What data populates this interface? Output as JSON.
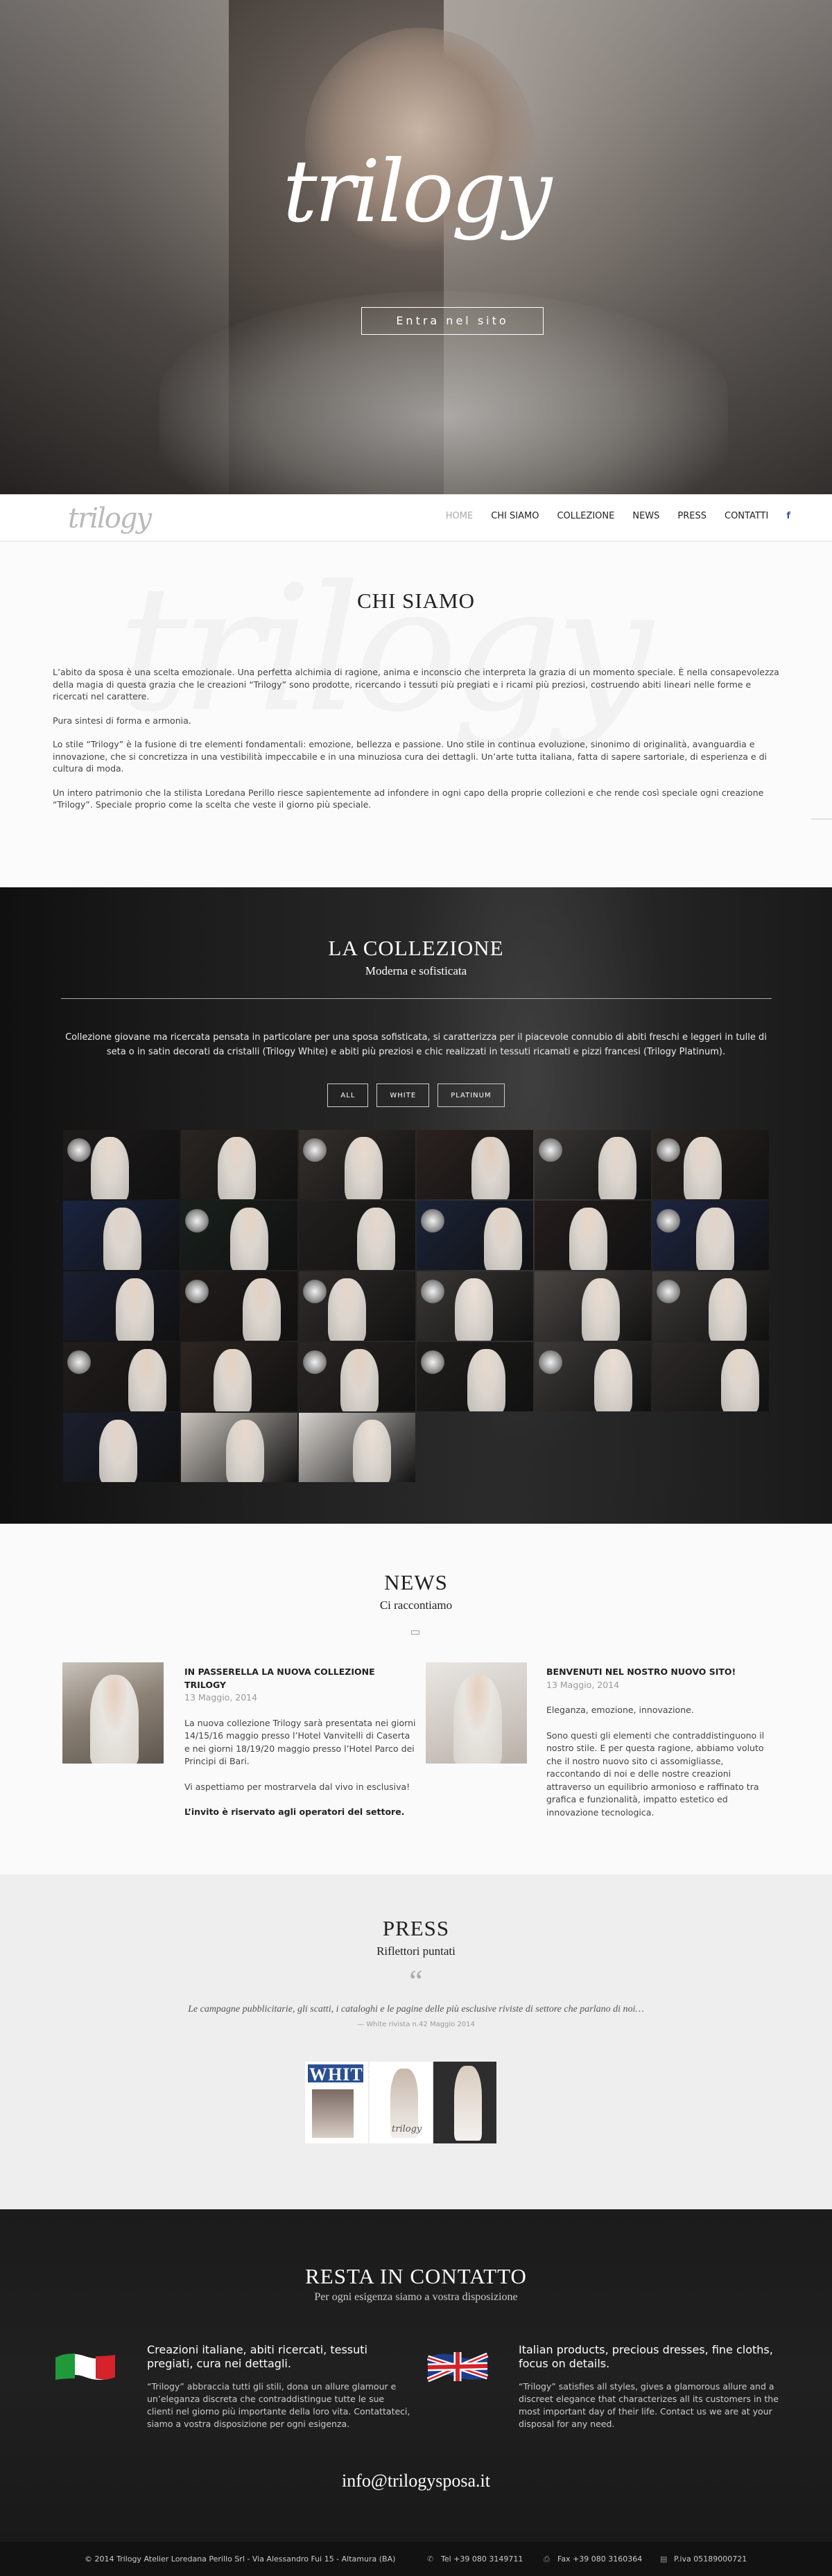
{
  "hero": {
    "logo": "trilogy",
    "enter_label": "Entra nel sito"
  },
  "nav": {
    "brand": "trilogy",
    "items": [
      {
        "label": "HOME",
        "active": true
      },
      {
        "label": "CHI SIAMO",
        "active": false
      },
      {
        "label": "COLLEZIONE",
        "active": false
      },
      {
        "label": "NEWS",
        "active": false
      },
      {
        "label": "PRESS",
        "active": false
      },
      {
        "label": "CONTATTI",
        "active": false
      }
    ],
    "social_icon": "facebook-icon",
    "social_glyph": "f"
  },
  "chi_siamo": {
    "watermark": "trilogy",
    "title": "CHI SIAMO",
    "paragraphs": [
      "L’abito da sposa è una scelta emozionale. Una perfetta alchimia di ragione, anima e inconscio che interpreta la grazia di un momento speciale. È nella consapevolezza della magia di questa grazia che le creazioni “Trilogy” sono prodotte, ricercando i tessuti più pregiati e i ricami più preziosi, costruendo abiti lineari nelle forme e ricercati nel carattere.",
      "Pura sintesi di forma e armonia.",
      "Lo stile “Trilogy” è la fusione di tre elementi fondamentali: emozione, bellezza e passione. Uno stile in continua evoluzione, sinonimo di originalità, avanguardia e innovazione, che si concretizza in una vestibilità impeccabile e in una minuziosa cura dei dettagli. Un’arte tutta italiana, fatta di sapere sartoriale, di esperienza e di cultura di moda.",
      "Un intero patrimonio che la stilista Loredana Perillo riesce sapientemente ad infondere in ogni capo della proprie collezioni e che rende così speciale ogni creazione “Trilogy”. Speciale proprio come la scelta che veste il giorno più speciale."
    ]
  },
  "collezione": {
    "title": "LA COLLEZIONE",
    "subtitle": "Moderna e sofisticata",
    "description": "Collezione giovane ma ricercata pensata in particolare per una sposa sofisticata, si caratterizza per il piacevole connubio di abiti freschi e leggeri in tulle di seta o in satin decorati da cristalli (Trilogy White) e abiti più preziosi e chic realizzati in tessuti ricamati e pizzi francesi (Trilogy Platinum).",
    "filters": [
      "ALL",
      "WHITE",
      "PLATINUM"
    ],
    "tiles": [
      {
        "bg": "#1d1a1a",
        "skin": "#e8d9cc",
        "lamp": true
      },
      {
        "bg": "#2a2522",
        "skin": "#e6d4c6",
        "lamp": false
      },
      {
        "bg": "#35302c",
        "skin": "#ead8c9",
        "lamp": true
      },
      {
        "bg": "#2b2220",
        "skin": "#e3cdbb",
        "lamp": false
      },
      {
        "bg": "#3a3734",
        "skin": "#e6d6ca",
        "lamp": true
      },
      {
        "bg": "#2a2420",
        "skin": "#e8d5c6",
        "lamp": true
      },
      {
        "bg": "#1a2440",
        "skin": "#e0d2c8",
        "lamp": false
      },
      {
        "bg": "#18201c",
        "skin": "#e6d4c4",
        "lamp": true
      },
      {
        "bg": "#22201e",
        "skin": "#e7d7ca",
        "lamp": false
      },
      {
        "bg": "#1c2338",
        "skin": "#e4d1c3",
        "lamp": true
      },
      {
        "bg": "#241d1c",
        "skin": "#ead6c6",
        "lamp": false
      },
      {
        "bg": "#1d2542",
        "skin": "#e4d4c9",
        "lamp": true
      },
      {
        "bg": "#1a1e30",
        "skin": "#e6d3c4",
        "lamp": false
      },
      {
        "bg": "#221c1a",
        "skin": "#e5d1c1",
        "lamp": true
      },
      {
        "bg": "#302c2a",
        "skin": "#e7d6c8",
        "lamp": true
      },
      {
        "bg": "#3b3836",
        "skin": "#ece0d6",
        "lamp": true
      },
      {
        "bg": "#4a4643",
        "skin": "#e9dbcf",
        "lamp": false
      },
      {
        "bg": "#3c3936",
        "skin": "#e7d8cb",
        "lamp": true
      },
      {
        "bg": "#211c1b",
        "skin": "#e3cfbe",
        "lamp": true
      },
      {
        "bg": "#2d2521",
        "skin": "#e6d2c1",
        "lamp": false
      },
      {
        "bg": "#2a2523",
        "skin": "#e4d0c0",
        "lamp": true
      },
      {
        "bg": "#1f1d1c",
        "skin": "#e8d8cb",
        "lamp": true
      },
      {
        "bg": "#3d3a38",
        "skin": "#ebddd2",
        "lamp": true
      },
      {
        "bg": "#2d2a28",
        "skin": "#e6d6c8",
        "lamp": false
      },
      {
        "bg": "#1b1f2d",
        "skin": "#e4d3c6",
        "lamp": false
      },
      {
        "bg": "#c9c3bc",
        "skin": "#e9d8ca",
        "lamp": false
      },
      {
        "bg": "#d8d4cf",
        "skin": "#ecdfd4",
        "lamp": false
      }
    ]
  },
  "news": {
    "title": "NEWS",
    "subtitle": "Ci raccontiamo",
    "articles": [
      {
        "title": "IN PASSERELLA LA NUOVA COLLEZIONE TRILOGY",
        "date": "13 Maggio, 2014",
        "p1": "La nuova collezione Trilogy sarà presentata nei giorni 14/15/16 maggio presso l’Hotel Vanvitelli di Caserta e nei giorni 18/19/20 maggio presso l’Hotel Parco dei Principi di Bari.",
        "p2": "Vi aspettiamo per mostrarvela dal vivo in esclusiva!",
        "p3": "L’invito è riservato agli operatori del settore."
      },
      {
        "title": "BENVENUTI NEL NOSTRO NUOVO SITO!",
        "date": "13 Maggio, 2014",
        "p1": "Eleganza, emozione, innovazione.",
        "p2": "Sono questi gli elementi che contraddistinguono il nostro stile. E per questa ragione, abbiamo voluto che il nostro nuovo sito ci assomigliasse, raccontando di noi e delle nostre creazioni attraverso un equilibrio armonioso e raffinato tra grafica e funzionalità, impatto estetico ed innovazione tecnologica."
      }
    ]
  },
  "press": {
    "title": "PRESS",
    "subtitle": "Riflettori puntati",
    "quote_glyph": "“",
    "quote": "Le campagne pubblicitarie, gli scatti, i cataloghi e le pagine delle più esclusive riviste di settore che parlano di noi…",
    "cite": "— White rivista n.42 Maggio 2014",
    "mag_title": "WHITE",
    "mag_brand": "trilogy"
  },
  "contatto": {
    "title": "RESTA IN CONTATTO",
    "subtitle": "Per ogni esigenza siamo a vostra disposizione",
    "it": {
      "heading": "Creazioni italiane, abiti ricercati, tessuti pregiati, cura nei dettagli.",
      "body": "“Trilogy” abbraccia tutti gli stili, dona un allure glamour e un’eleganza discreta che contraddistingue tutte le sue clienti nel giorno più importante della loro vita. Contattateci, siamo a vostra disposizione per ogni esigenza."
    },
    "en": {
      "heading": "Italian products, precious dresses, fine cloths, focus on details.",
      "body": "“Trilogy” satisfies all styles, gives a glamorous allure and a discreet elegance that characterizes all its customers in the most important day of their life. Contact us we are at your disposal for any need."
    },
    "email": "info@trilogysposa.it"
  },
  "footer": {
    "copyright": "© 2014 Trilogy Atelier Loredana Perillo Srl - Via Alessandro Fui 15 - Altamura (BA)",
    "tel": "Tel +39 080 3149711",
    "fax": "Fax +39 080 3160364",
    "piva": "P.iva 05189000721",
    "tel_glyph": "✆",
    "fax_glyph": "⎙",
    "piva_glyph": "▤"
  }
}
